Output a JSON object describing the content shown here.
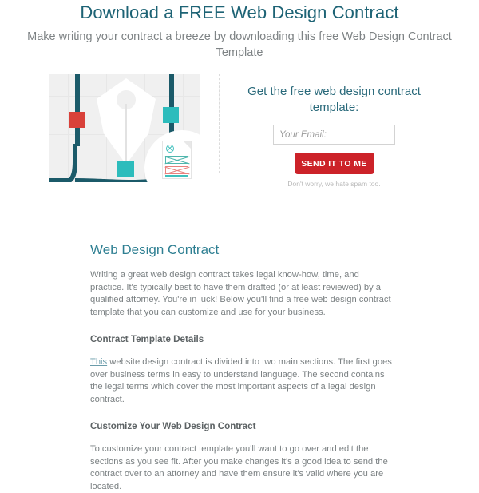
{
  "hero": {
    "title": "Download a FREE Web Design Contract",
    "subtitle": "Make writing your contract a breeze by downloading this free Web Design Contract Template",
    "title_color": "#1d6375"
  },
  "illustration": {
    "name": "pen-nib-bezier-illustration",
    "handle_red_color": "#d9413a",
    "handle_teal_color": "#2dbcbc",
    "path_color": "#1b5a69",
    "background_color": "#f0f0f0",
    "document_badge_color": "#3fc0bd",
    "document_box_red_color": "#e8827f"
  },
  "form": {
    "heading": "Get the free web design contract template:",
    "email_value": "",
    "email_placeholder": "Your Email:",
    "submit_label": "SEND IT TO ME",
    "submit_color": "#cc2229",
    "spam_note": "Don't worry, we hate spam too."
  },
  "article": {
    "title": "Web Design Contract",
    "intro": "Writing a great web design contract takes legal know-how, time, and practice. It's typically best to have them drafted (or at least reviewed) by a qualified attorney. You're in luck! Below you'll find a free web design contract template that you can customize and use for your business.",
    "section_1_heading": "Contract Template Details",
    "section_1_link": "This",
    "section_1_body": " website design contract is divided into two main sections. The first goes over business terms in easy to understand language. The second contains the legal terms which cover the most important aspects of a legal design contract.",
    "section_2_heading": "Customize Your Web Design Contract",
    "section_2_body": "To customize your contract template you'll want to go over and edit the sections as you see fit. After you make changes it's a good idea to send the contract over to an attorney and have them ensure it's valid where you are located."
  }
}
